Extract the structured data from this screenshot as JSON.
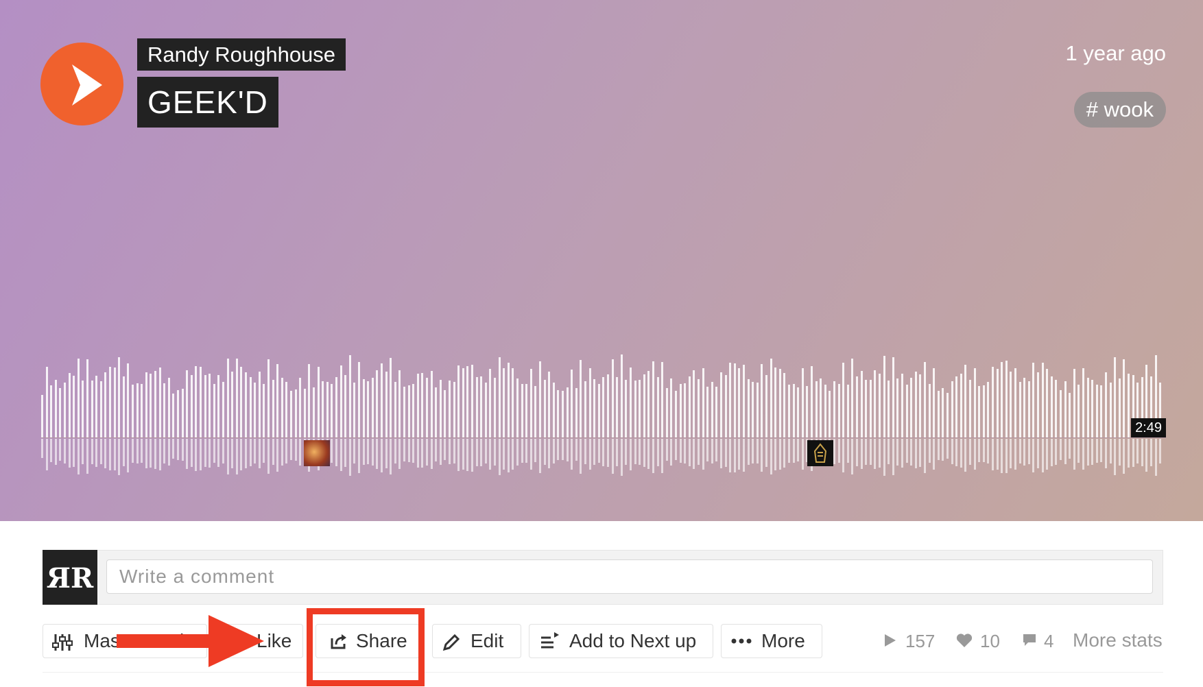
{
  "track": {
    "artist": "Randy Roughhouse",
    "title": "GEEK'D",
    "time_ago": "1 year ago",
    "tag": "# wook",
    "duration": "2:49"
  },
  "comment": {
    "placeholder": "Write a comment"
  },
  "actions": {
    "master": "Master track",
    "like": "Like",
    "share": "Share",
    "edit": "Edit",
    "next_up": "Add to Next up",
    "more": "More"
  },
  "stats": {
    "plays": "157",
    "likes": "10",
    "comments": "4",
    "more_stats": "More stats"
  },
  "colors": {
    "play_accent": "#f0612d",
    "annotation": "#ee3b24"
  },
  "icons": [
    "play-icon",
    "sliders-icon",
    "heart-icon",
    "share-icon",
    "pencil-icon",
    "queue-icon",
    "dots-icon",
    "play-count-icon",
    "comment-bubble-icon"
  ]
}
